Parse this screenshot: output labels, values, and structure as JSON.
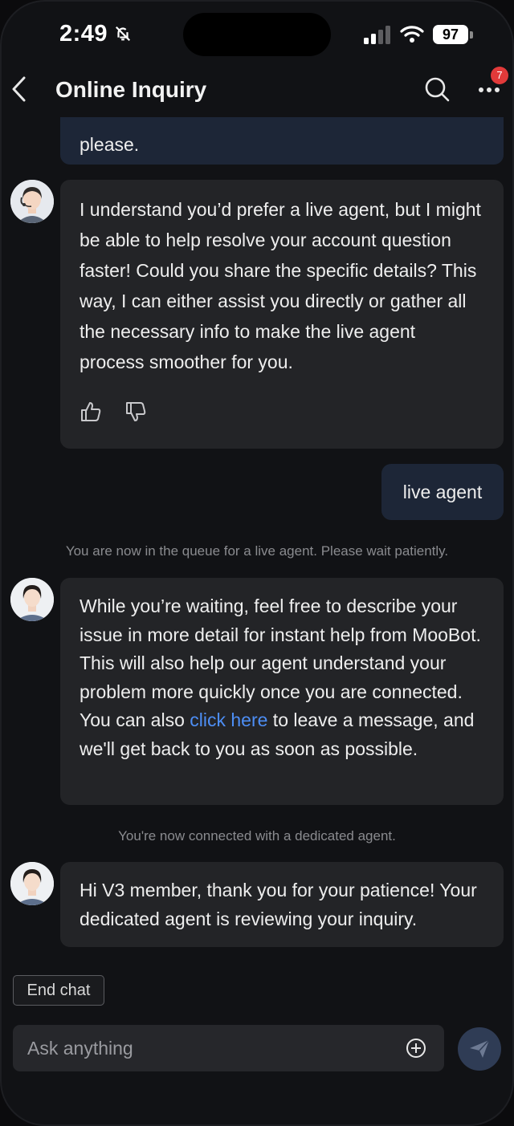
{
  "status_bar": {
    "time": "2:49",
    "battery": "97",
    "corner": "J"
  },
  "header": {
    "title": "Online Inquiry",
    "notification_count": "7"
  },
  "messages": {
    "m1": {
      "text": "please."
    },
    "m2": {
      "text": "I understand you’d prefer a live agent, but I might be able to help resolve your account question faster! Could you share the specific details? This way, I can either assist you directly or gather all the necessary info to make the live agent process smoother for you."
    },
    "m3": {
      "text": "live agent"
    },
    "sys1": {
      "text": "You are now in the queue for a live agent. Please wait patiently."
    },
    "m4": {
      "text_before": "While you’re waiting, feel free to describe your issue in more detail for instant help from MooBot. This will also help our agent understand your problem more quickly once you are connected. You can also ",
      "link": "click here",
      "text_after": " to leave a message, and we'll get back to you as soon as possible."
    },
    "sys2": {
      "text": "You're now connected with a dedicated agent."
    },
    "m5": {
      "text": "Hi V3 member, thank you for your patience! Your dedicated agent is reviewing your inquiry."
    }
  },
  "controls": {
    "end_chat": "End chat",
    "input_placeholder": "Ask anything"
  },
  "icons": {
    "back": "chevron-left-icon",
    "search": "search-icon",
    "more": "more-dots-icon",
    "thumbs_up": "thumbs-up-icon",
    "thumbs_down": "thumbs-down-icon",
    "plus": "plus-circle-icon",
    "send": "send-icon"
  },
  "colors": {
    "background": "#111215",
    "user_bubble": "#1d2637",
    "bot_bubble": "#232427",
    "link": "#4d8ef5",
    "badge": "#e23a3a"
  }
}
